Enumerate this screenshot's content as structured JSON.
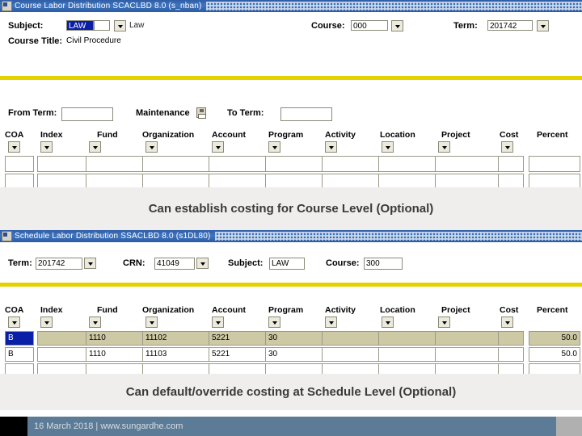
{
  "top_form": {
    "title": "Course Labor Distribution  SCACLBD 8.0  (s_nban)",
    "subject_label": "Subject:",
    "subject_value": "LAW",
    "subject_desc": "Law",
    "course_title_label": "Course Title:",
    "course_title_value": "Civil Procedure",
    "course_label": "Course:",
    "course_value": "000",
    "term_label": "Term:",
    "term_value": "201742",
    "from_term_label": "From Term:",
    "from_term_value": "",
    "maintenance_label": "Maintenance",
    "to_term_label": "To Term:",
    "to_term_value": "",
    "columns": [
      "COA",
      "Index",
      "Fund",
      "Organization",
      "Account",
      "Program",
      "Activity",
      "Location",
      "Project",
      "Cost",
      "Percent"
    ],
    "rows": [
      {
        "COA": "",
        "Index": "",
        "Fund": "",
        "Organization": "",
        "Account": "",
        "Program": "",
        "Activity": "",
        "Location": "",
        "Project": "",
        "Cost": "",
        "Percent": ""
      },
      {
        "COA": "",
        "Index": "",
        "Fund": "",
        "Organization": "",
        "Account": "",
        "Program": "",
        "Activity": "",
        "Location": "",
        "Project": "",
        "Cost": "",
        "Percent": ""
      }
    ]
  },
  "caption_top": "Can establish costing for Course Level (Optional)",
  "bottom_form": {
    "title": "Schedule Labor Distribution  SSACLBD 8.0  (s1DL80)",
    "term_label": "Term:",
    "term_value": "201742",
    "crn_label": "CRN:",
    "crn_value": "41049",
    "subject_label": "Subject:",
    "subject_value": "LAW",
    "course_label": "Course:",
    "course_value": "300",
    "columns": [
      "COA",
      "Index",
      "Fund",
      "Organization",
      "Account",
      "Program",
      "Activity",
      "Location",
      "Project",
      "Cost",
      "Percent"
    ],
    "rows": [
      {
        "COA": "B",
        "Index": "",
        "Fund": "1110",
        "Organization": "11102",
        "Account": "5221",
        "Program": "30",
        "Activity": "",
        "Location": "",
        "Project": "",
        "Cost": "",
        "Percent": "50.0"
      },
      {
        "COA": "B",
        "Index": "",
        "Fund": "1110",
        "Organization": "11103",
        "Account": "5221",
        "Program": "30",
        "Activity": "",
        "Location": "",
        "Project": "",
        "Cost": "",
        "Percent": "50.0"
      },
      {
        "COA": "",
        "Index": "",
        "Fund": "",
        "Organization": "",
        "Account": "",
        "Program": "",
        "Activity": "",
        "Location": "",
        "Project": "",
        "Cost": "",
        "Percent": ""
      },
      {
        "COA": "",
        "Index": "",
        "Fund": "",
        "Organization": "",
        "Account": "",
        "Program": "",
        "Activity": "",
        "Location": "",
        "Project": "",
        "Cost": "",
        "Percent": ""
      }
    ]
  },
  "caption_bottom": "Can default/override costing at Schedule Level (Optional)",
  "footer": {
    "text": "16 March 2018 | www.sungardhe.com"
  },
  "colors": {
    "titlebar": "#3f74bf",
    "accent_yellow": "#e2d200",
    "highlight_row": "#cdc9a5",
    "cursor_blue": "#0a1fa8",
    "footer_bar": "#5c7b96"
  }
}
